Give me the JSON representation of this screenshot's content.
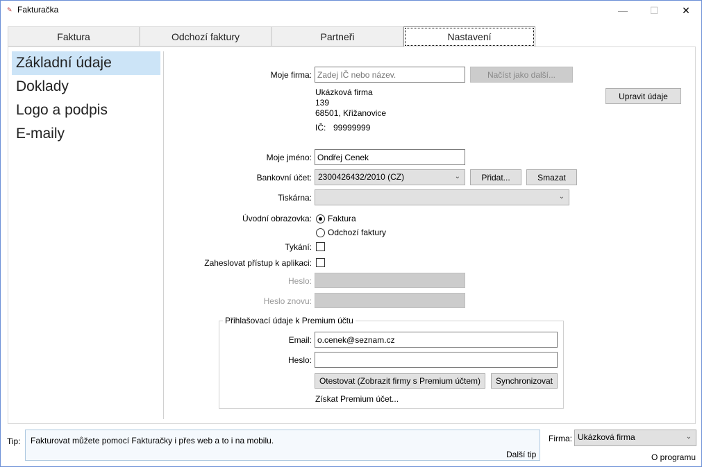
{
  "window": {
    "title": "Fakturačka",
    "minimize": "—",
    "maximize": "☐",
    "close": "✕"
  },
  "tabs": [
    {
      "label": "Faktura"
    },
    {
      "label": "Odchozí faktury"
    },
    {
      "label": "Partneři"
    },
    {
      "label": "Nastavení"
    }
  ],
  "sidebar": {
    "items": [
      {
        "label": "Základní údaje"
      },
      {
        "label": "Doklady"
      },
      {
        "label": "Logo a podpis"
      },
      {
        "label": "E-maily"
      }
    ]
  },
  "form": {
    "firma_label": "Moje firma:",
    "firma_placeholder": "Zadej IČ nebo název.",
    "load_button": "Načíst jako další...",
    "company": {
      "name": "Ukázková firma",
      "street": "139",
      "city": "68501, Křižanovice",
      "ic_label": "IČ:",
      "ic": "99999999"
    },
    "edit_button": "Upravit údaje",
    "name_label": "Moje jméno:",
    "name_value": "Ondřej Cenek",
    "bank_label": "Bankovní účet:",
    "bank_value": "2300426432/2010 (CZ)",
    "add_button": "Přidat...",
    "delete_button": "Smazat",
    "printer_label": "Tiskárna:",
    "printer_value": "",
    "start_label": "Úvodní obrazovka:",
    "start_options": [
      {
        "label": "Faktura",
        "selected": true
      },
      {
        "label": "Odchozí faktury",
        "selected": false
      }
    ],
    "tykani_label": "Tykání:",
    "tykani": false,
    "lock_label": "Zaheslovat přístup k aplikaci:",
    "lock": false,
    "password_label": "Heslo:",
    "password_again_label": "Heslo znovu:"
  },
  "premium": {
    "legend": "Přihlašovací údaje k Premium účtu",
    "email_label": "Email:",
    "email_value": "o.cenek@seznam.cz",
    "password_label": "Heslo:",
    "password_value": "",
    "test_button": "Otestovat (Zobrazit firmy s Premium účtem)",
    "sync_button": "Synchronizovat",
    "get_link": "Získat Premium účet..."
  },
  "footer": {
    "tip_label": "Tip:",
    "tip_text": "Fakturovat můžete pomocí Fakturačky i přes web a to i na mobilu.",
    "next_tip": "Další tip",
    "firma_label": "Firma:",
    "firma_value": "Ukázková firma",
    "about": "O programu"
  }
}
